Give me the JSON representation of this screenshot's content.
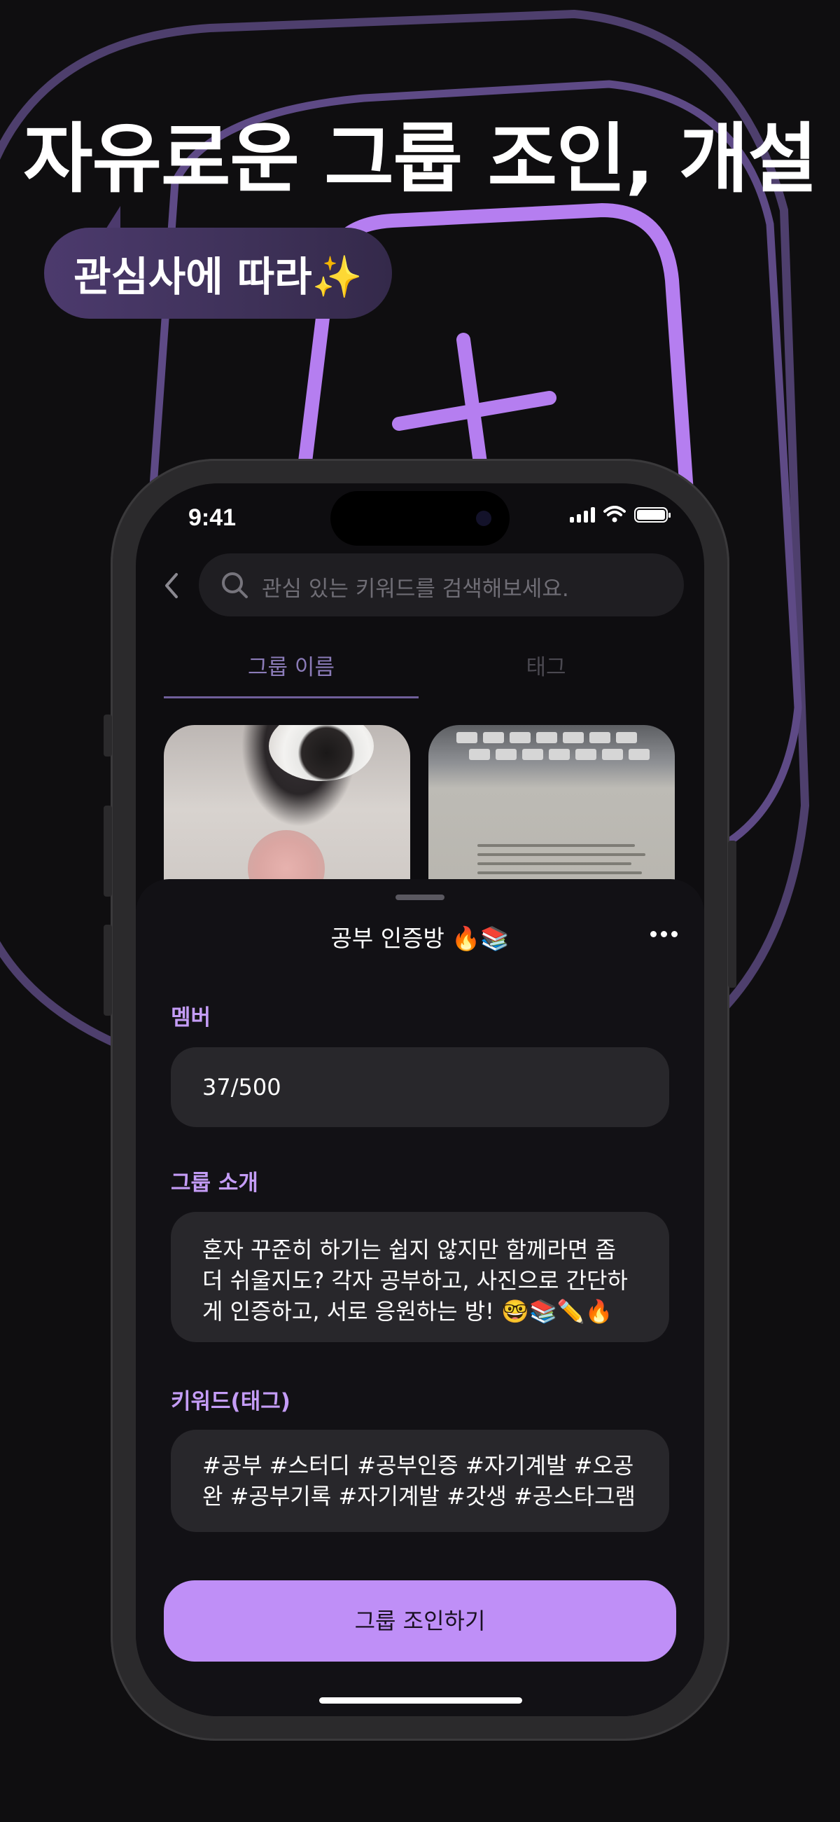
{
  "promo": {
    "headline": "자유로운 그룹 조인, 개설",
    "bubble": "관심사에 따라✨"
  },
  "colors": {
    "accent": "#bf8ff7",
    "label": "#c49cf6",
    "background": "#0f0e10",
    "field": "#28272b"
  },
  "status_bar": {
    "time": "9:41"
  },
  "search": {
    "placeholder": "관심 있는 키워드를 검색해보세요."
  },
  "tabs": [
    {
      "label": "그룹 이름",
      "active": true
    },
    {
      "label": "태그",
      "active": false
    }
  ],
  "sheet": {
    "title": "공부 인증방 🔥📚",
    "member_label": "멤버",
    "member_value": "37/500",
    "intro_label": "그룹 소개",
    "intro_text": "혼자 꾸준히 하기는 쉽지 않지만 함께라면 좀 더 쉬울지도? 각자 공부하고, 사진으로 간단하게 인증하고, 서로 응원하는 방! 🤓📚✏️🔥",
    "tags_label": "키워드(태그)",
    "tags_text": "#공부 #스터디 #공부인증 #자기계발 #오공완 #공부기록 #자기계발 #갓생 #공스타그램",
    "join_label": "그룹 조인하기"
  },
  "icons": [
    "back-chevron-icon",
    "search-icon",
    "more-dots-icon",
    "signal-icon",
    "wifi-icon",
    "battery-icon",
    "plus-icon"
  ]
}
